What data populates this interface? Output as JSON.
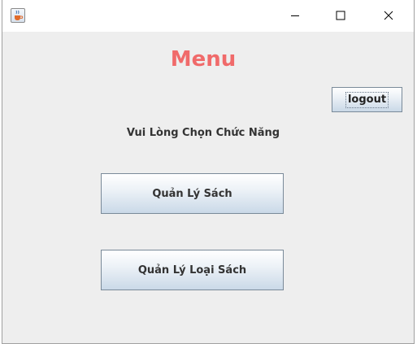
{
  "window": {
    "icon": "java-cup-icon",
    "controls": {
      "minimize": "minimize-icon",
      "maximize": "maximize-icon",
      "close": "close-icon"
    }
  },
  "main": {
    "title": "Menu",
    "title_color": "#f06a6a",
    "logout_label": "logout",
    "subtitle": "Vui Lòng Chọn Chức Năng",
    "buttons": [
      {
        "label": "Quản Lý Sách"
      },
      {
        "label": "Quản Lý Loại Sách"
      }
    ]
  }
}
